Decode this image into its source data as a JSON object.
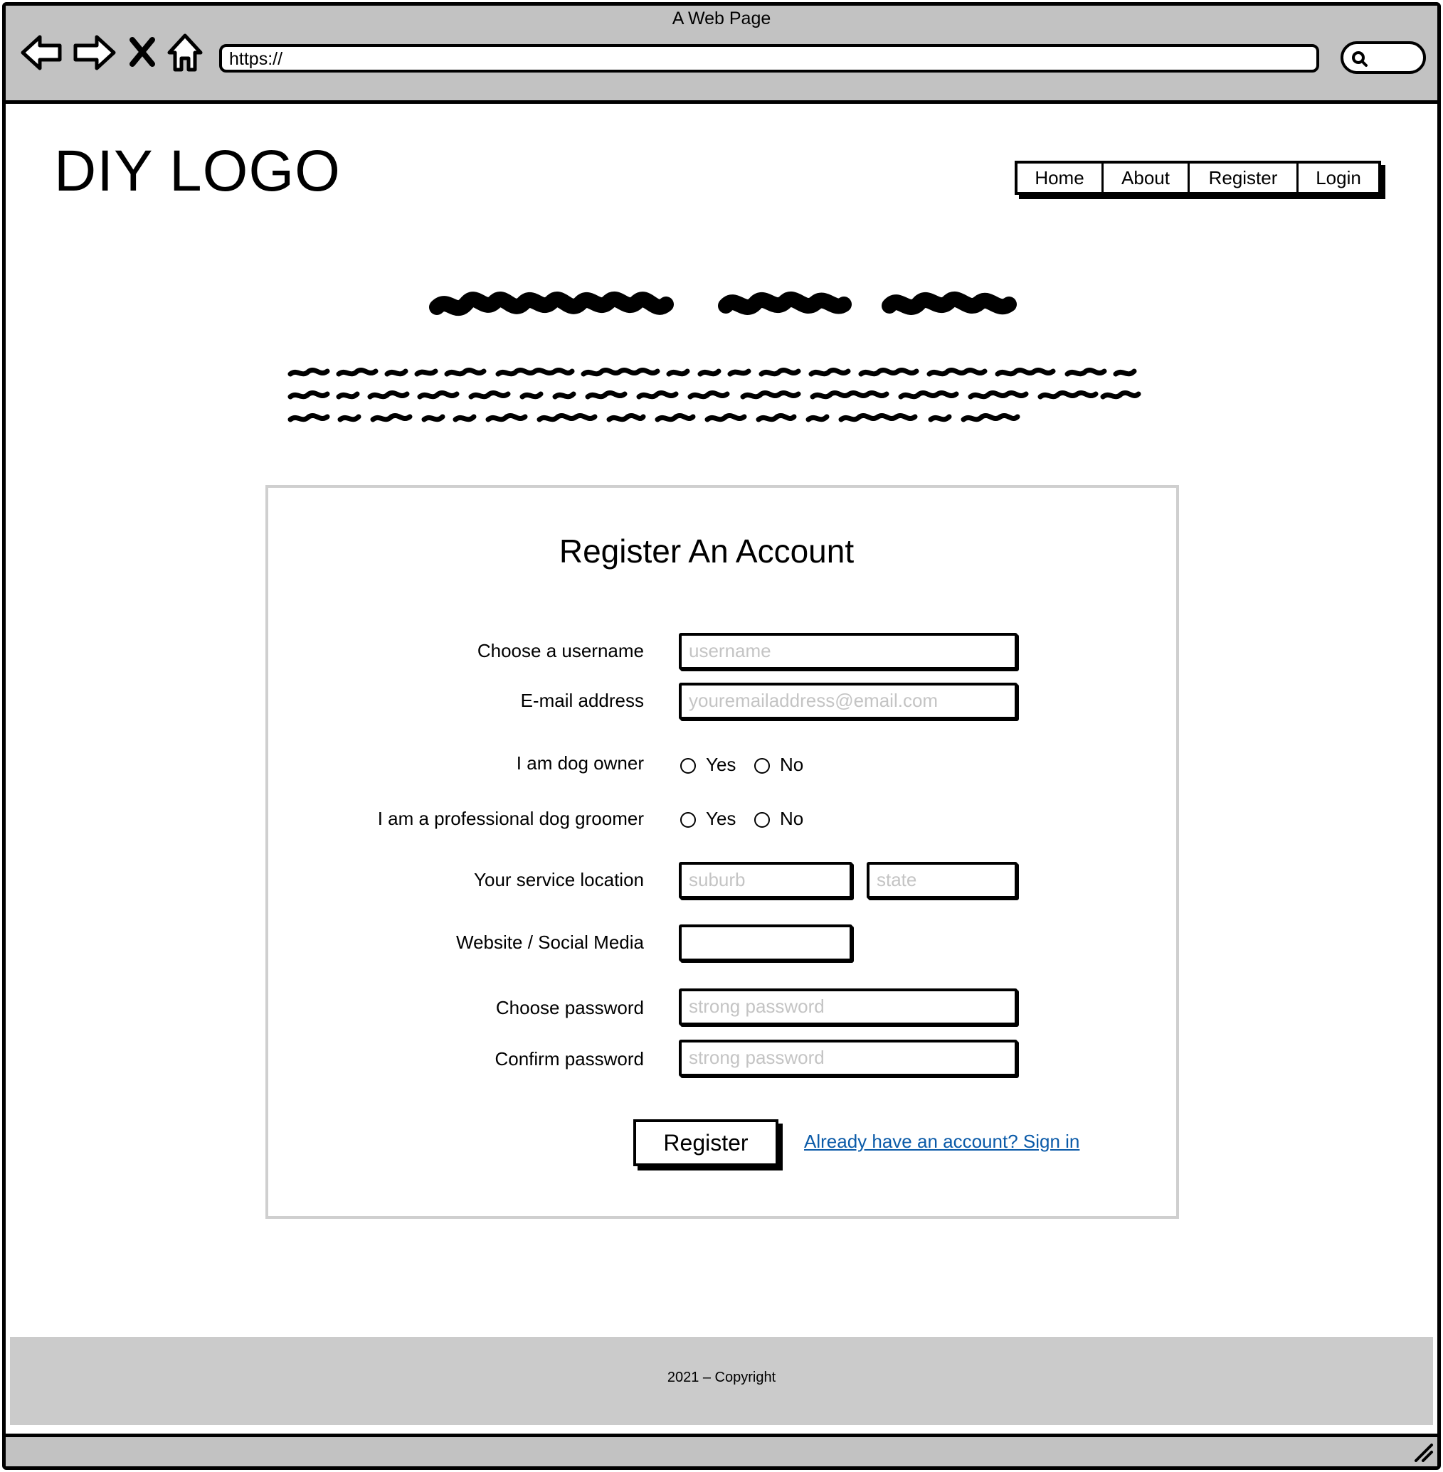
{
  "browser": {
    "window_title": "A Web Page",
    "url": "https://",
    "icons": [
      "back-arrow-icon",
      "forward-arrow-icon",
      "stop-icon",
      "home-icon",
      "search-icon",
      "resize-grip-icon"
    ]
  },
  "header": {
    "logo": "DIY LOGO",
    "nav": [
      {
        "label": "Home"
      },
      {
        "label": "About"
      },
      {
        "label": "Register"
      },
      {
        "label": "Login"
      }
    ]
  },
  "form": {
    "title": "Register An Account",
    "username": {
      "label": "Choose a username",
      "placeholder": "username"
    },
    "email": {
      "label": "E-mail address",
      "placeholder": "youremailaddress@email.com"
    },
    "dog_owner": {
      "label": "I am dog owner",
      "yes": "Yes",
      "no": "No"
    },
    "groomer": {
      "label": "I am a professional dog groomer",
      "yes": "Yes",
      "no": "No"
    },
    "location": {
      "label": "Your service location",
      "suburb_placeholder": "suburb",
      "state_placeholder": "state"
    },
    "website": {
      "label": "Website / Social Media",
      "placeholder": ""
    },
    "password": {
      "label": "Choose password",
      "placeholder": "strong password"
    },
    "confirm": {
      "label": "Confirm password",
      "placeholder": "strong password"
    },
    "submit_label": "Register",
    "signin_link": "Already have an account? Sign in"
  },
  "footer": {
    "copyright": "2021 – Copyright"
  },
  "colors": {
    "chrome": "#c2c2c2",
    "footer": "#cbcbcb",
    "panel_border": "#cfcfcf",
    "placeholder": "#c4c4c4",
    "link": "#0a5aa8"
  }
}
